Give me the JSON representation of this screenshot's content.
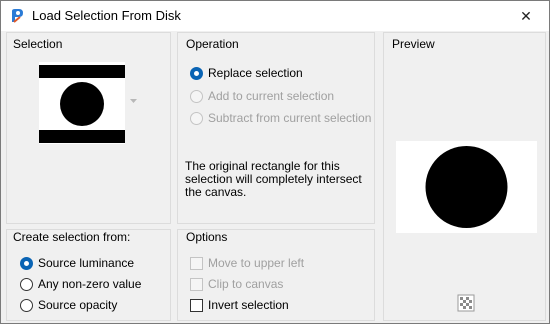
{
  "window": {
    "title": "Load Selection From Disk",
    "close_glyph": "✕"
  },
  "selection": {
    "title": "Selection"
  },
  "operation": {
    "title": "Operation",
    "options": [
      {
        "label": "Replace selection",
        "checked": true,
        "enabled": true
      },
      {
        "label": "Add to current selection",
        "checked": false,
        "enabled": false
      },
      {
        "label": "Subtract from current selection",
        "checked": false,
        "enabled": false
      }
    ],
    "description": "The original rectangle for this selection will completely intersect the canvas."
  },
  "preview": {
    "title": "Preview"
  },
  "create_from": {
    "title": "Create selection from:",
    "options": [
      {
        "label": "Source luminance",
        "checked": true
      },
      {
        "label": "Any non-zero value",
        "checked": false
      },
      {
        "label": "Source opacity",
        "checked": false
      }
    ]
  },
  "options": {
    "title": "Options",
    "items": [
      {
        "label": "Move to upper left",
        "checked": false,
        "enabled": false
      },
      {
        "label": "Clip to canvas",
        "checked": false,
        "enabled": false
      },
      {
        "label": "Invert selection",
        "checked": false,
        "enabled": true
      }
    ]
  },
  "colors": {
    "accent": "#0a64b4",
    "panel_border": "#dcdcdc",
    "disabled_text": "#a0a0a0"
  }
}
